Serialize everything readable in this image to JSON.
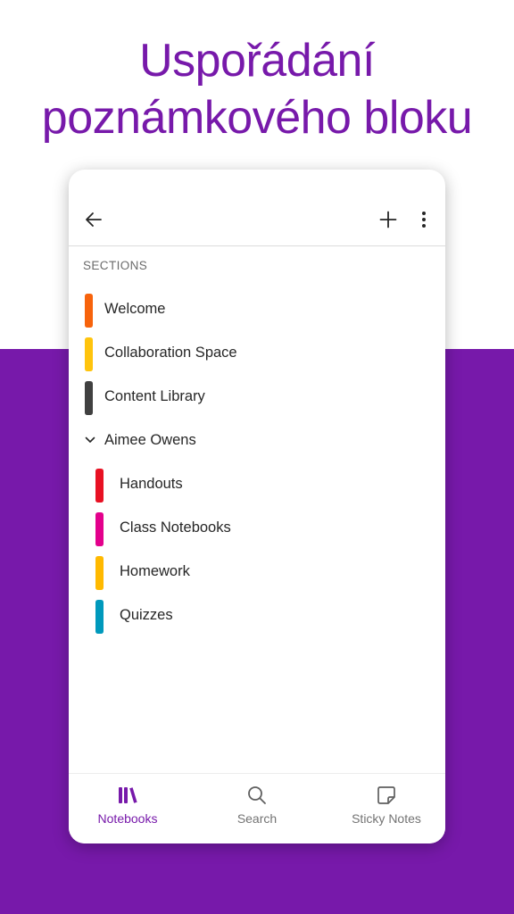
{
  "headline": {
    "line1": "Uspořádání",
    "line2": "poznámkového bloku"
  },
  "toolbar": {
    "back_icon": "arrow-left-icon",
    "add_icon": "plus-icon",
    "more_icon": "more-vertical-icon"
  },
  "sections": {
    "header": "SECTIONS",
    "items": [
      {
        "label": "Welcome",
        "color": "#f7630c"
      },
      {
        "label": "Collaboration Space",
        "color": "#ffc40d"
      },
      {
        "label": "Content Library",
        "color": "#404040"
      }
    ],
    "group": {
      "label": "Aimee Owens",
      "expanded": true,
      "items": [
        {
          "label": "Handouts",
          "color": "#e81123"
        },
        {
          "label": "Class Notebooks",
          "color": "#e3008c"
        },
        {
          "label": "Homework",
          "color": "#ffb900"
        },
        {
          "label": "Quizzes",
          "color": "#0099bc"
        }
      ]
    }
  },
  "bottom_nav": {
    "items": [
      {
        "label": "Notebooks",
        "icon": "notebooks-icon",
        "active": true
      },
      {
        "label": "Search",
        "icon": "search-icon",
        "active": false
      },
      {
        "label": "Sticky Notes",
        "icon": "sticky-note-icon",
        "active": false
      }
    ]
  },
  "colors": {
    "brand_purple": "#7719aa"
  }
}
